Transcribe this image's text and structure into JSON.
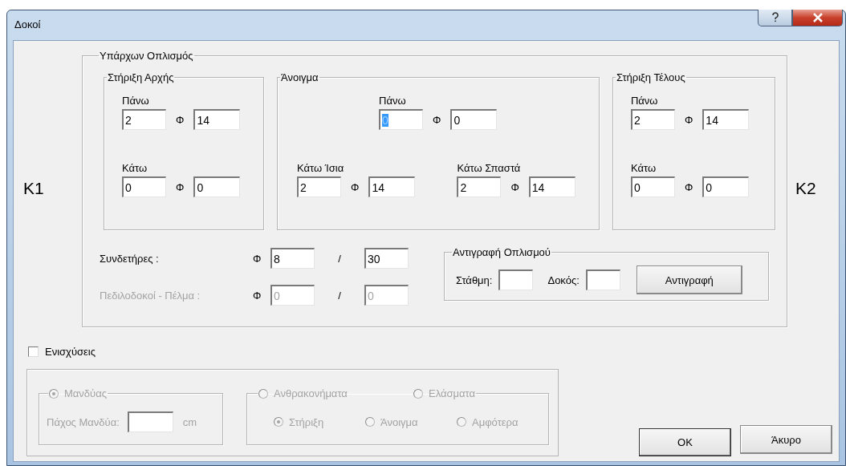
{
  "window": {
    "title": "Δοκοί"
  },
  "left_node": "K1",
  "right_node": "K2",
  "existing": {
    "title": "Υπάρχων Οπλισμός",
    "start_support": {
      "title": "Στήριξη Αρχής",
      "rows": [
        {
          "label": "Πάνω",
          "count": "2",
          "symbol": "Φ",
          "diameter": "14",
          "focused": false
        },
        {
          "label": "Κάτω",
          "count": "0",
          "symbol": "Φ",
          "diameter": "0",
          "focused": false
        }
      ]
    },
    "span": {
      "title": "Άνοιγμα",
      "rows": [
        {
          "label": "Πάνω",
          "count": "0",
          "symbol": "Φ",
          "diameter": "0",
          "focused": true
        },
        {
          "label": "Κάτω Ίσια",
          "count": "2",
          "symbol": "Φ",
          "diameter": "14",
          "focused": false
        },
        {
          "label": "Κάτω Σπαστά",
          "count": "2",
          "symbol": "Φ",
          "diameter": "14",
          "focused": false
        }
      ]
    },
    "end_support": {
      "title": "Στήριξη Τέλους",
      "rows": [
        {
          "label": "Πάνω",
          "count": "2",
          "symbol": "Φ",
          "diameter": "14",
          "focused": false
        },
        {
          "label": "Κάτω",
          "count": "0",
          "symbol": "Φ",
          "diameter": "0",
          "focused": false
        }
      ]
    },
    "stirrups": [
      {
        "label": "Συνδετήρες :",
        "symbol": "Φ",
        "diameter": "8",
        "separator": "/",
        "spacing": "30",
        "disabled": false
      },
      {
        "label": "Πεδιλοδοκοί - Πέλμα :",
        "symbol": "Φ",
        "diameter": "0",
        "separator": "/",
        "spacing": "0",
        "disabled": true
      }
    ],
    "copy": {
      "title": "Αντιγραφή Οπλισμού",
      "level_label": "Στάθμη:",
      "beam_label": "Δοκός:",
      "button": "Αντιγραφή"
    }
  },
  "reinforcement": {
    "label": "Ενισχύσεις",
    "checked": false
  },
  "jacket": {
    "option": {
      "label": "Μανδύας",
      "selected": true
    },
    "thickness_label": "Πάχος Μανδύα:",
    "unit": "cm"
  },
  "materials": {
    "options": [
      {
        "label": "Ανθρακονήματα",
        "selected": false
      },
      {
        "label": "Ελάσματα",
        "selected": false
      }
    ],
    "positions": [
      {
        "label": "Στήριξη",
        "selected": true
      },
      {
        "label": "Άνοιγμα",
        "selected": false
      },
      {
        "label": "Αμφότερα",
        "selected": false
      }
    ]
  },
  "buttons": [
    {
      "label": "OK",
      "default": true
    },
    {
      "label": "Άκυρο",
      "default": false
    }
  ]
}
